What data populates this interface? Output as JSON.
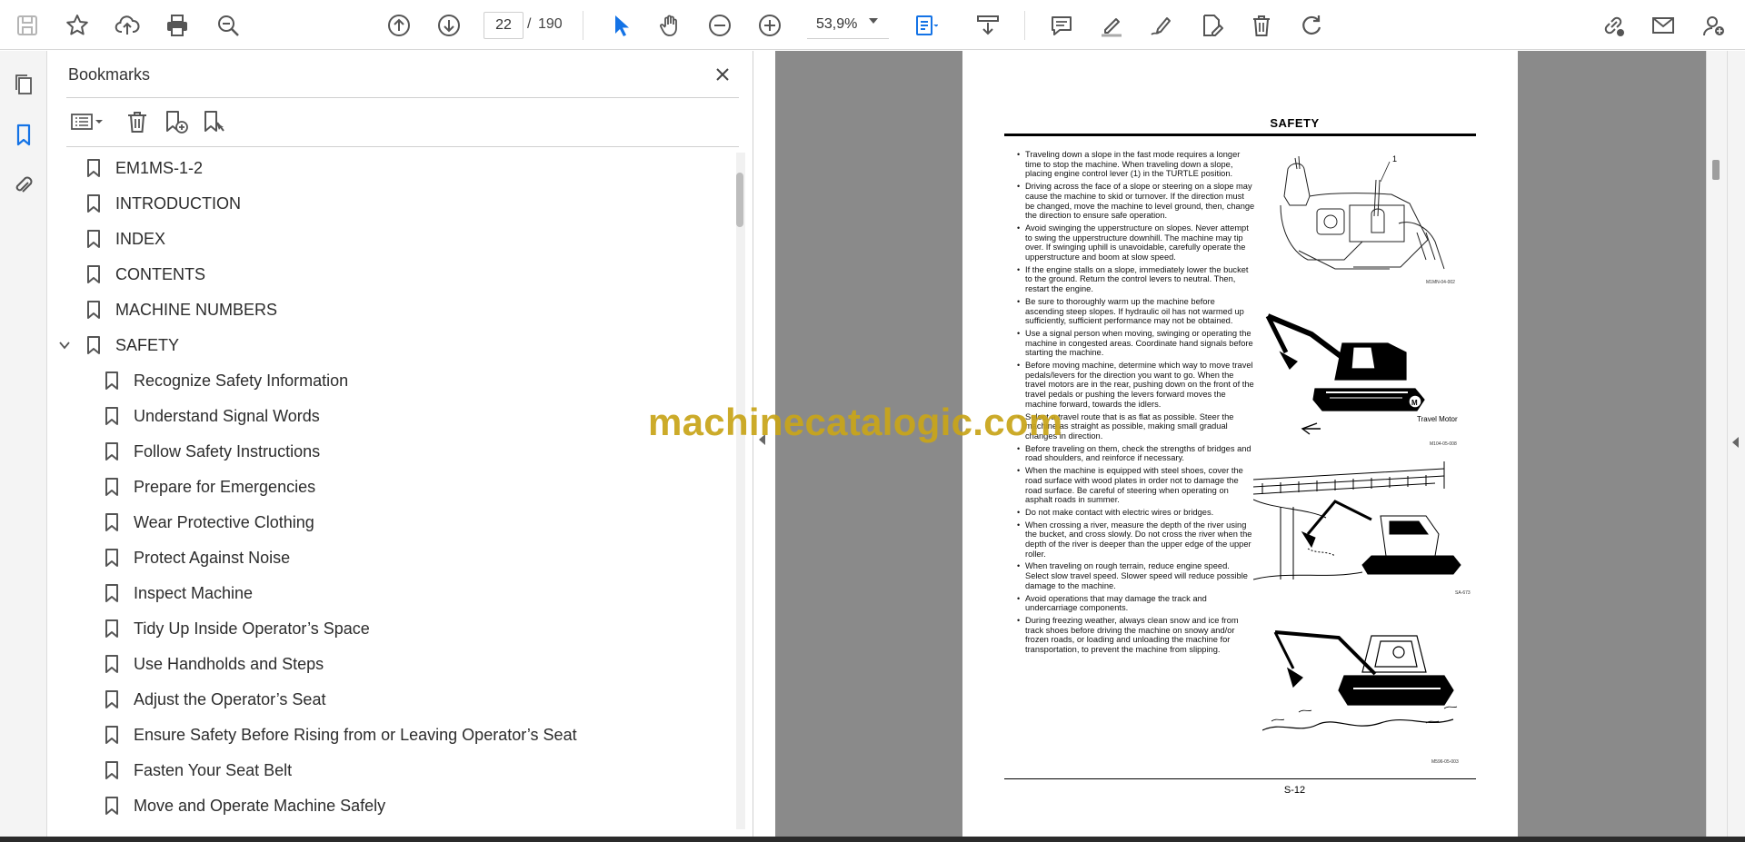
{
  "toolbar": {
    "page_current": "22",
    "page_separator": "/",
    "page_total": "190",
    "zoom": "53,9%",
    "accent_color": "#1473e6"
  },
  "bookmarks_panel": {
    "title": "Bookmarks",
    "items": [
      {
        "label": "EM1MS-1-2",
        "level": 0
      },
      {
        "label": "INTRODUCTION",
        "level": 0
      },
      {
        "label": "INDEX",
        "level": 0
      },
      {
        "label": "CONTENTS",
        "level": 0
      },
      {
        "label": "MACHINE NUMBERS",
        "level": 0
      },
      {
        "label": "SAFETY",
        "level": 0,
        "expanded": true
      },
      {
        "label": "Recognize Safety Information",
        "level": 1
      },
      {
        "label": "Understand Signal Words",
        "level": 1
      },
      {
        "label": "Follow Safety Instructions",
        "level": 1
      },
      {
        "label": "Prepare for Emergencies",
        "level": 1
      },
      {
        "label": "Wear Protective Clothing",
        "level": 1
      },
      {
        "label": "Protect Against Noise",
        "level": 1
      },
      {
        "label": "Inspect Machine",
        "level": 1
      },
      {
        "label": "Tidy Up Inside Operator’s Space",
        "level": 1
      },
      {
        "label": "Use Handholds and Steps",
        "level": 1
      },
      {
        "label": "Adjust the Operator’s Seat",
        "level": 1
      },
      {
        "label": "Ensure Safety Before Rising from or Leaving Operator’s Seat",
        "level": 1
      },
      {
        "label": "Fasten Your Seat Belt",
        "level": 1
      },
      {
        "label": "Move and Operate Machine Safely",
        "level": 1
      }
    ]
  },
  "document": {
    "title": "SAFETY",
    "footer": "S-12",
    "bullets": [
      "Traveling down a slope in the fast mode requires a longer time to stop the machine. When traveling down a slope, placing engine control lever (1) in the TURTLE position.",
      "Driving across the face of a slope or steering on a slope may cause the machine to skid or turnover. If the direction must be changed, move the machine to level ground, then, change the direction to ensure safe operation.",
      "Avoid swinging the upperstructure on slopes. Never attempt to swing the upperstructure downhill. The machine may tip over. If swinging uphill is unavoidable, carefully operate the upperstructure and boom at slow speed.",
      "If the engine stalls on a slope, immediately lower the bucket to the ground. Return the control levers to neutral. Then, restart the engine.",
      "Be sure to thoroughly warm up the machine before ascending steep slopes. If hydraulic oil has not warmed up sufficiently, sufficient performance may not be obtained.",
      "Use a signal person when moving, swinging or operating the machine in congested areas. Coordinate hand signals before starting the machine.",
      "Before moving machine, determine which way to move travel pedals/levers for the direction you want to go. When the travel motors are in the rear, pushing down on the front of the travel pedals or pushing the levers forward moves the machine forward, towards the idlers.",
      "Select a travel route that is as flat as possible. Steer the machine as straight as possible, making small gradual changes in direction.",
      "Before traveling on them, check the strengths of bridges and road shoulders, and reinforce if necessary.",
      "When the machine is equipped with steel shoes, cover the road surface with wood plates in order not to damage the road surface. Be careful of steering when operating on asphalt roads in summer.",
      "Do not make contact with electric wires or bridges.",
      "When crossing a river, measure the depth of the river using the bucket, and cross slowly. Do not cross the river when the depth of the river is deeper than the upper edge of the upper roller.",
      "When traveling on rough terrain, reduce engine speed. Select slow travel speed. Slower speed will reduce possible damage to the machine.",
      "Avoid operations that may damage the track and undercarriage components.",
      "During freezing weather, always clean snow and ice from track shoes before driving the machine on snowy and/or frozen roads, or loading and unloading the machine for transportation, to prevent the machine from slipping."
    ],
    "figures": {
      "fig1_callout": "1",
      "fig1_caption": "M1MN-04-002",
      "fig2_label": "Travel Motor",
      "fig2_m": "M",
      "fig2_caption": "M104-05-008",
      "fig3_caption": "SA-673",
      "fig4_caption": "M596-05-003"
    },
    "watermark": "machinecatalogic.com"
  }
}
